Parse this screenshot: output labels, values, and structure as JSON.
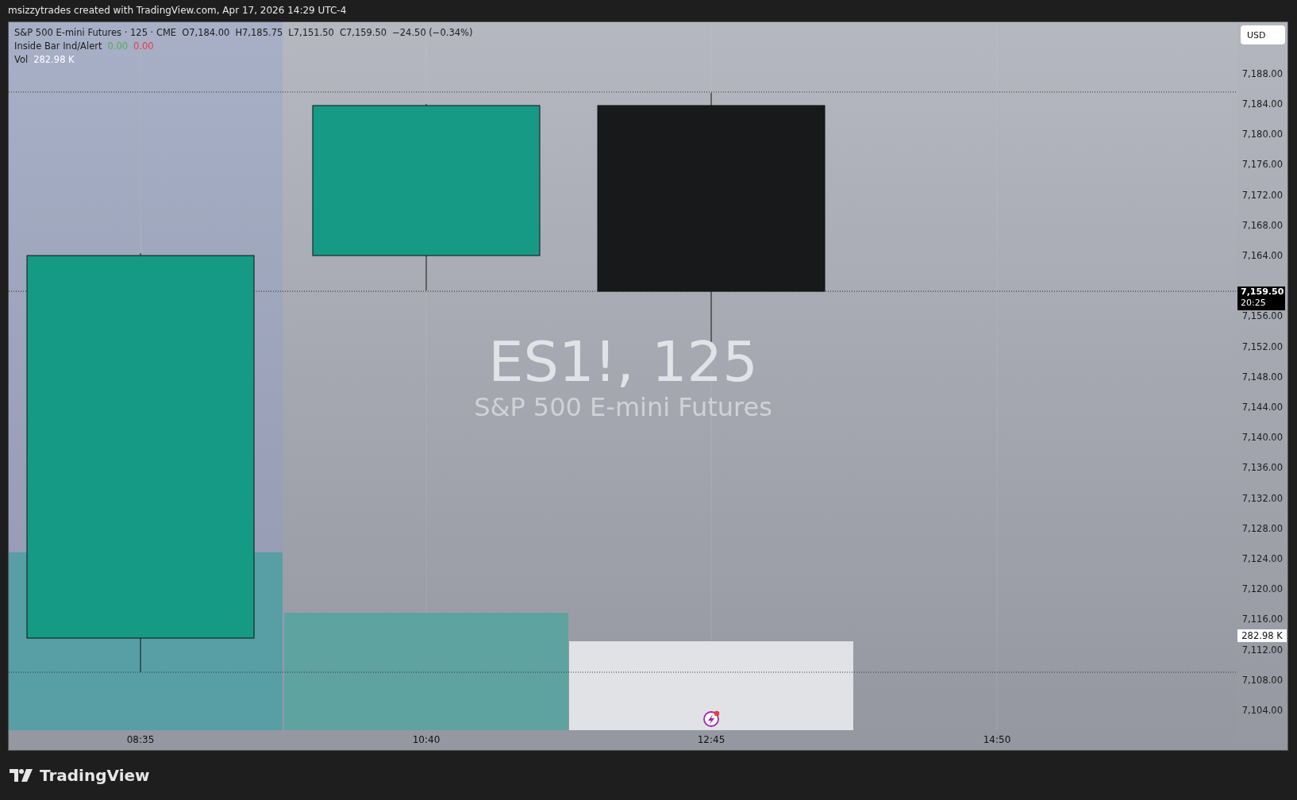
{
  "header": {
    "text": "msizzytrades created with TradingView.com, Apr 17, 2026 14:29 UTC-4"
  },
  "legend": {
    "symbol": "S&P 500 E-mini Futures · 125 · CME",
    "ohlc": [
      "O7,184.00",
      "H7,185.75",
      "L7,151.50",
      "C7,159.50"
    ],
    "change": "−24.50 (−0.34%)"
  },
  "indicators": [
    {
      "name": "Inside Bar Ind/Alert",
      "values": [
        {
          "text": "0.00",
          "color": "#4caf50"
        },
        {
          "text": "0.00",
          "color": "#f23645"
        }
      ]
    },
    {
      "name": "Vol",
      "values": [
        {
          "text": "282.98 K",
          "color": "#ffffff"
        }
      ]
    }
  ],
  "currency_button": "USD",
  "watermark": {
    "symbol": "ES1!, 125",
    "description": "S&P 500 E-mini Futures"
  },
  "price_axis": {
    "ticks": [
      "7,188.00",
      "7,184.00",
      "7,180.00",
      "7,176.00",
      "7,172.00",
      "7,168.00",
      "7,164.00",
      "7,156.00",
      "7,152.00",
      "7,148.00",
      "7,144.00",
      "7,140.00",
      "7,136.00",
      "7,132.00",
      "7,128.00",
      "7,124.00",
      "7,120.00",
      "7,116.00",
      "7,112.00",
      "7,108.00",
      "7,104.00"
    ],
    "last_price": {
      "price": "7,159.50",
      "countdown": "20:25"
    },
    "volume_label": "282.98 K"
  },
  "time_axis": [
    "08:35",
    "10:40",
    "12:45",
    "14:50"
  ],
  "footer": {
    "brand": "TradingView"
  }
}
